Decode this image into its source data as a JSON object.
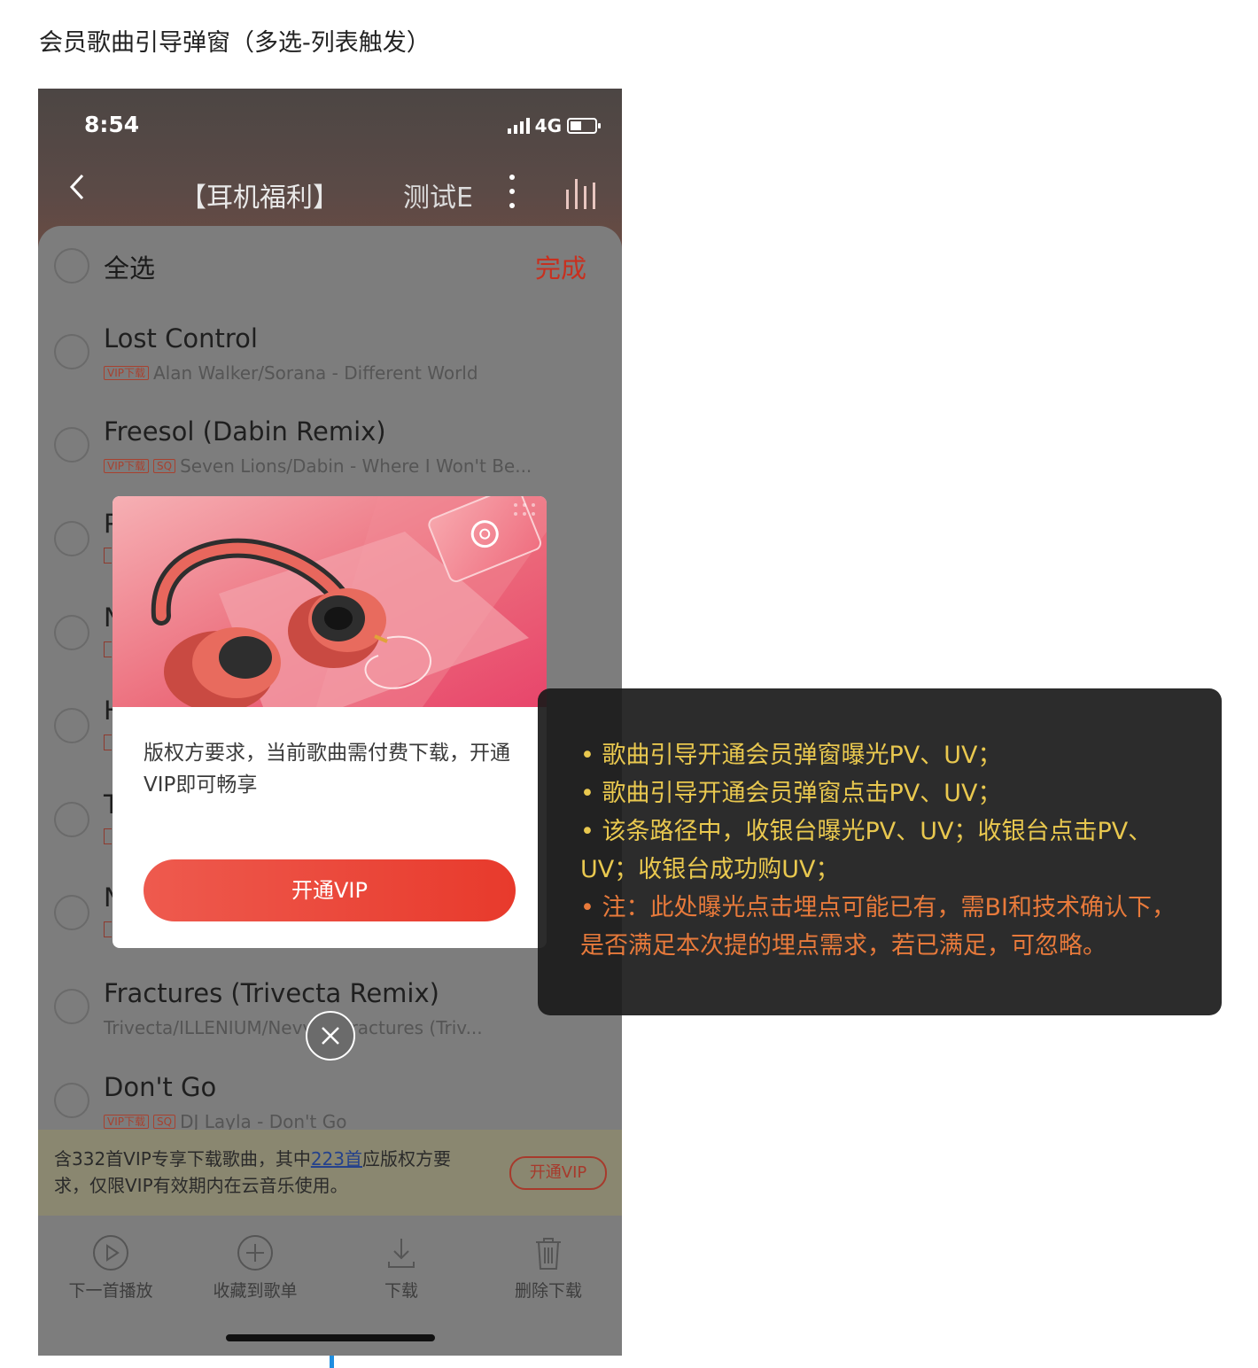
{
  "doc": {
    "title": "会员歌曲引导弹窗（多选-列表触发）"
  },
  "status": {
    "time": "8:54",
    "network": "4G"
  },
  "nav": {
    "title_left": "【耳机福利】",
    "title_right": "测试E"
  },
  "select": {
    "select_all": "全选",
    "done": "完成"
  },
  "songs": [
    {
      "title": "Lost Control",
      "tags": [
        "VIP下载"
      ],
      "subtitle": "Alan Walker/Sorana - Different World"
    },
    {
      "title": "Freesol (Dabin Remix)",
      "tags": [
        "VIP下载",
        "SQ"
      ],
      "subtitle": "Seven Lions/Dabin - Where I Won't Be..."
    },
    {
      "title": "P"
    },
    {
      "title": "N"
    },
    {
      "title": "H"
    },
    {
      "title": "T"
    },
    {
      "title": "N"
    },
    {
      "title": "Fractures (Trivecta Remix)",
      "tags": [],
      "subtitle": "Trivecta/ILLENIUM/Nevve - Fractures (Triv..."
    },
    {
      "title": "Don't Go",
      "tags": [
        "VIP下载",
        "SQ"
      ],
      "subtitle": "DJ Layla - Don't Go"
    }
  ],
  "banner": {
    "text_before": "含332首VIP专享下载歌曲，其中",
    "link": "223首",
    "text_after": "应版权方要求，仅限VIP有效期内在云音乐使用。",
    "button": "开通VIP"
  },
  "toolbar": [
    {
      "label": "下一首播放",
      "icon": "play-next-icon"
    },
    {
      "label": "收藏到歌单",
      "icon": "add-to-playlist-icon"
    },
    {
      "label": "下载",
      "icon": "download-icon"
    },
    {
      "label": "删除下载",
      "icon": "trash-icon"
    }
  ],
  "modal": {
    "text": "版权方要求，当前歌曲需付费下载，开通VIP即可畅享",
    "button": "开通VIP"
  },
  "note": {
    "line1": "• 歌曲引导开通会员弹窗曝光PV、UV；",
    "line2": "• 歌曲引导开通会员弹窗点击PV、UV；",
    "line3": "• 该条路径中，收银台曝光PV、UV；收银台点击PV、",
    "line4": "UV；收银台成功购UV；",
    "line5": "• 注：此处曝光点击埋点可能已有，需BI和技术确认下，",
    "line6": "是否满足本次提的埋点需求，若已满足，可忽略。"
  },
  "colors": {
    "accent": "#e83a2c",
    "note_yellow": "#e9c84f",
    "note_orange": "#e87a3b"
  }
}
